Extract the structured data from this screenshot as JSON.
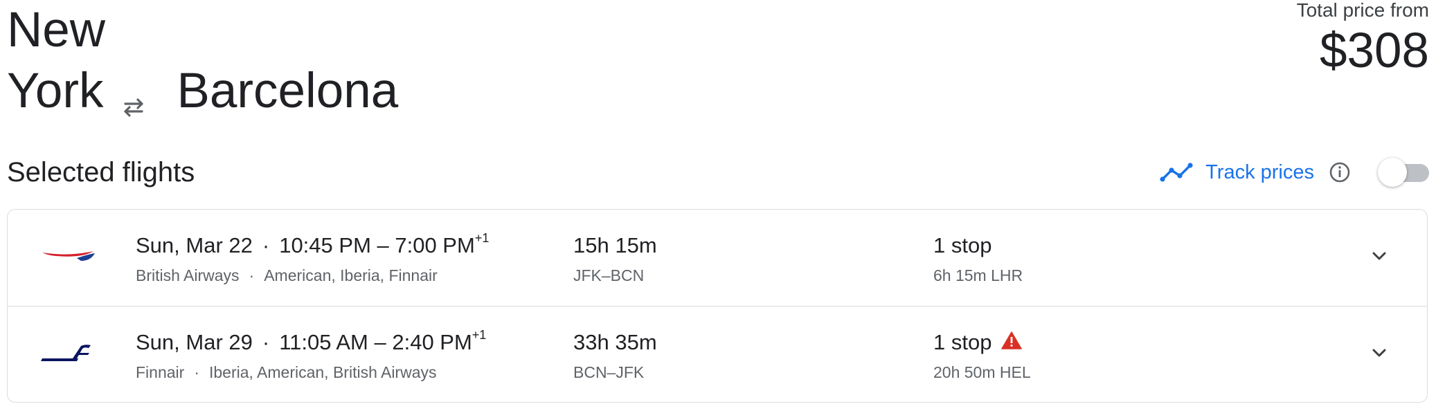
{
  "header": {
    "origin_line1": "New",
    "origin_line2": "York",
    "destination": "Barcelona",
    "price_label": "Total price from",
    "price": "$308"
  },
  "selected": {
    "title": "Selected flights",
    "track_label": "Track prices",
    "track_enabled": false
  },
  "flights": [
    {
      "date": "Sun, Mar 22",
      "times": "10:45 PM – 7:00 PM",
      "day_offset": "+1",
      "airline": "British Airways",
      "partners": "American, Iberia, Finnair",
      "duration": "15h 15m",
      "route": "JFK–BCN",
      "stops": "1 stop",
      "layover": "6h 15m LHR",
      "warning": false
    },
    {
      "date": "Sun, Mar 29",
      "times": "11:05 AM – 2:40 PM",
      "day_offset": "+1",
      "airline": "Finnair",
      "partners": "Iberia, American, British Airways",
      "duration": "33h 35m",
      "route": "BCN–JFK",
      "stops": "1 stop",
      "layover": "20h 50m HEL",
      "warning": true
    }
  ],
  "colors": {
    "accent": "#1a73e8",
    "warning": "#d93025",
    "ba_red": "#d4202a",
    "ba_blue": "#1b3f94",
    "finnair_blue": "#0b1560"
  },
  "icons": {
    "swap": "swap-arrows-icon",
    "trend": "trend-line-icon",
    "info": "info-icon",
    "warning": "warning-icon",
    "expand": "chevron-down-icon"
  }
}
